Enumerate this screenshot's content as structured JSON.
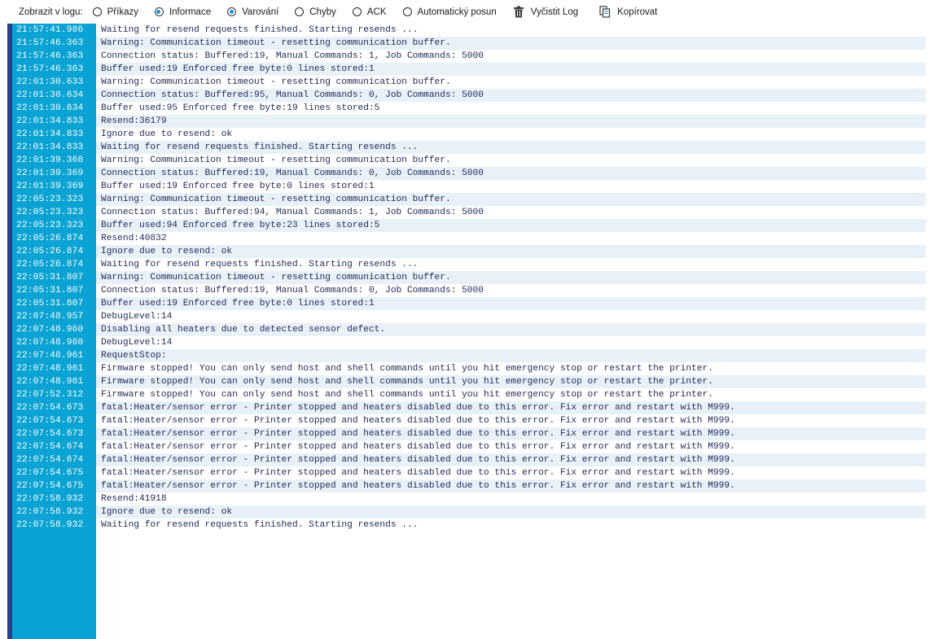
{
  "toolbar": {
    "show_label": "Zobrazit v logu:",
    "filters": [
      {
        "label": "Příkazy",
        "checked": false
      },
      {
        "label": "Informace",
        "checked": true
      },
      {
        "label": "Varování",
        "checked": true
      },
      {
        "label": "Chyby",
        "checked": false
      },
      {
        "label": "ACK",
        "checked": false
      },
      {
        "label": "Automatický posun",
        "checked": false
      }
    ],
    "clear_label": "Vyčistit Log",
    "copy_label": "Kopírovat"
  },
  "colors": {
    "timestamp_column": "#0aa3d3",
    "row_stripe": "#e8f1f8",
    "message_text": "#1f2a57",
    "accent": "#2c3e8f"
  },
  "log": [
    {
      "ts": "21:57:41.986",
      "msg": "Waiting for resend requests finished. Starting resends ..."
    },
    {
      "ts": "21:57:46.363",
      "msg": "Warning: Communication timeout - resetting communication buffer."
    },
    {
      "ts": "21:57:46.363",
      "msg": "Connection status: Buffered:19, Manual Commands: 1, Job Commands: 5000"
    },
    {
      "ts": "21:57:46.363",
      "msg": "Buffer used:19 Enforced free byte:0 lines stored:1"
    },
    {
      "ts": "22:01:30.633",
      "msg": "Warning: Communication timeout - resetting communication buffer."
    },
    {
      "ts": "22:01:30.634",
      "msg": "Connection status: Buffered:95, Manual Commands: 0, Job Commands: 5000"
    },
    {
      "ts": "22:01:30.634",
      "msg": "Buffer used:95 Enforced free byte:19 lines stored:5"
    },
    {
      "ts": "22:01:34.833",
      "msg": "Resend:36179"
    },
    {
      "ts": "22:01:34.833",
      "msg": "Ignore due to resend: ok"
    },
    {
      "ts": "22:01:34.833",
      "msg": "Waiting for resend requests finished. Starting resends ..."
    },
    {
      "ts": "22:01:39.368",
      "msg": "Warning: Communication timeout - resetting communication buffer."
    },
    {
      "ts": "22:01:39.369",
      "msg": "Connection status: Buffered:19, Manual Commands: 0, Job Commands: 5000"
    },
    {
      "ts": "22:01:39.369",
      "msg": "Buffer used:19 Enforced free byte:0 lines stored:1"
    },
    {
      "ts": "22:05:23.323",
      "msg": "Warning: Communication timeout - resetting communication buffer."
    },
    {
      "ts": "22:05:23.323",
      "msg": "Connection status: Buffered:94, Manual Commands: 1, Job Commands: 5000"
    },
    {
      "ts": "22:05:23.323",
      "msg": "Buffer used:94 Enforced free byte:23 lines stored:5"
    },
    {
      "ts": "22:05:26.874",
      "msg": "Resend:40832"
    },
    {
      "ts": "22:05:26.874",
      "msg": "Ignore due to resend: ok"
    },
    {
      "ts": "22:05:26.874",
      "msg": "Waiting for resend requests finished. Starting resends ..."
    },
    {
      "ts": "22:05:31.807",
      "msg": "Warning: Communication timeout - resetting communication buffer."
    },
    {
      "ts": "22:05:31.807",
      "msg": "Connection status: Buffered:19, Manual Commands: 0, Job Commands: 5000"
    },
    {
      "ts": "22:05:31.807",
      "msg": "Buffer used:19 Enforced free byte:0 lines stored:1"
    },
    {
      "ts": "22:07:48.957",
      "msg": "DebugLevel:14"
    },
    {
      "ts": "22:07:48.960",
      "msg": "Disabling all heaters due to detected sensor defect."
    },
    {
      "ts": "22:07:48.960",
      "msg": "DebugLevel:14"
    },
    {
      "ts": "22:07:48.961",
      "msg": "RequestStop:"
    },
    {
      "ts": "22:07:48.961",
      "msg": "Firmware stopped! You can only send host and shell commands until you hit emergency stop or restart the printer."
    },
    {
      "ts": "22:07:48.961",
      "msg": "Firmware stopped! You can only send host and shell commands until you hit emergency stop or restart the printer."
    },
    {
      "ts": "22:07:52.312",
      "msg": "Firmware stopped! You can only send host and shell commands until you hit emergency stop or restart the printer."
    },
    {
      "ts": "22:07:54.673",
      "msg": "fatal:Heater/sensor error - Printer stopped and heaters disabled due to this error. Fix error and restart with M999."
    },
    {
      "ts": "22:07:54.673",
      "msg": "fatal:Heater/sensor error - Printer stopped and heaters disabled due to this error. Fix error and restart with M999."
    },
    {
      "ts": "22:07:54.673",
      "msg": "fatal:Heater/sensor error - Printer stopped and heaters disabled due to this error. Fix error and restart with M999."
    },
    {
      "ts": "22:07:54.674",
      "msg": "fatal:Heater/sensor error - Printer stopped and heaters disabled due to this error. Fix error and restart with M999."
    },
    {
      "ts": "22:07:54.674",
      "msg": "fatal:Heater/sensor error - Printer stopped and heaters disabled due to this error. Fix error and restart with M999."
    },
    {
      "ts": "22:07:54.675",
      "msg": "fatal:Heater/sensor error - Printer stopped and heaters disabled due to this error. Fix error and restart with M999."
    },
    {
      "ts": "22:07:54.675",
      "msg": "fatal:Heater/sensor error - Printer stopped and heaters disabled due to this error. Fix error and restart with M999."
    },
    {
      "ts": "22:07:58.932",
      "msg": "Resend:41918"
    },
    {
      "ts": "22:07:58.932",
      "msg": "Ignore due to resend: ok"
    },
    {
      "ts": "22:07:58.932",
      "msg": "Waiting for resend requests finished. Starting resends ..."
    }
  ]
}
